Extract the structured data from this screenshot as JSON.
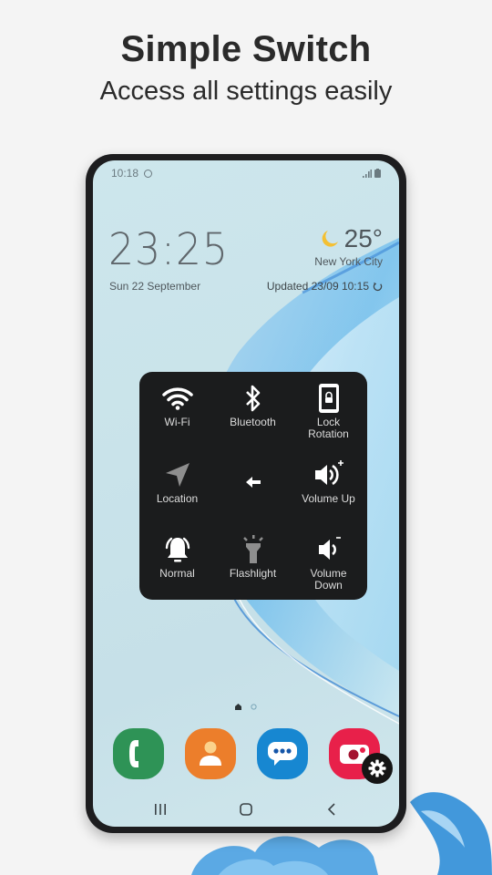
{
  "promo": {
    "title": "Simple Switch",
    "subtitle": "Access all settings easily"
  },
  "status_bar": {
    "time": "10:18",
    "icons": [
      "notification-circle-icon",
      "signal-icon",
      "battery-icon"
    ]
  },
  "lock_widget": {
    "clock": "23:25",
    "date": "Sun 22 September",
    "weather": {
      "icon": "moon-icon",
      "temperature": "25°",
      "city": "New York City",
      "updated": "Updated 23/09 10:15",
      "refresh_icon": "refresh-icon"
    }
  },
  "quick_panel": {
    "tiles": [
      {
        "label": "Wi-Fi",
        "icon": "wifi-icon",
        "state": "on"
      },
      {
        "label": "Bluetooth",
        "icon": "bluetooth-icon",
        "state": "on"
      },
      {
        "label": "Lock Rotation",
        "icon": "lock-rotation-icon",
        "state": "on"
      },
      {
        "label": "Location",
        "icon": "location-icon",
        "state": "off"
      },
      {
        "label": "",
        "icon": "back-arrow-icon",
        "state": "on"
      },
      {
        "label": "Volume Up",
        "icon": "volume-up-icon",
        "state": "on"
      },
      {
        "label": "Normal",
        "icon": "bell-icon",
        "state": "on"
      },
      {
        "label": "Flashlight",
        "icon": "flashlight-icon",
        "state": "off"
      },
      {
        "label": "Volume Down",
        "icon": "volume-down-icon",
        "state": "on"
      }
    ]
  },
  "home": {
    "page_indicator": {
      "pages": 2,
      "current": 1
    },
    "dock": [
      {
        "name": "Phone",
        "icon": "phone-icon",
        "color": "#2e9356"
      },
      {
        "name": "Contacts",
        "icon": "contacts-icon",
        "color": "#ec7e2b"
      },
      {
        "name": "Messages",
        "icon": "messages-icon",
        "color": "#1787d1"
      },
      {
        "name": "Screen Recorder",
        "icon": "camera-icon",
        "color": "#e8204a"
      }
    ],
    "settings_fab_icon": "gear-icon"
  },
  "nav_bar": {
    "recents": "recents-icon",
    "home": "home-icon",
    "back": "back-icon"
  },
  "colors": {
    "background": "#f4f4f4",
    "panel": "#1b1c1d",
    "tile_on": "#ffffff",
    "tile_off": "#8e8e8e",
    "moon": "#f4c033"
  }
}
